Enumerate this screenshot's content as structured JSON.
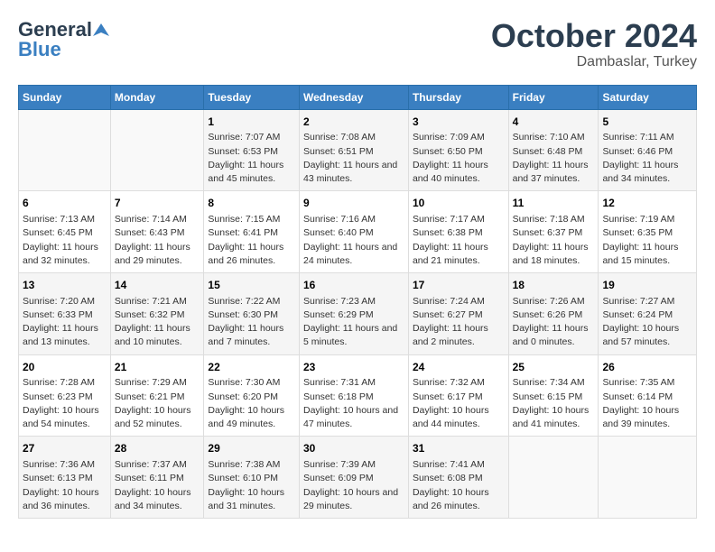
{
  "header": {
    "logo_general": "General",
    "logo_blue": "Blue",
    "month": "October 2024",
    "location": "Dambaslar, Turkey"
  },
  "days_of_week": [
    "Sunday",
    "Monday",
    "Tuesday",
    "Wednesday",
    "Thursday",
    "Friday",
    "Saturday"
  ],
  "weeks": [
    [
      {
        "day": "",
        "info": ""
      },
      {
        "day": "",
        "info": ""
      },
      {
        "day": "1",
        "info": "Sunrise: 7:07 AM\nSunset: 6:53 PM\nDaylight: 11 hours and 45 minutes."
      },
      {
        "day": "2",
        "info": "Sunrise: 7:08 AM\nSunset: 6:51 PM\nDaylight: 11 hours and 43 minutes."
      },
      {
        "day": "3",
        "info": "Sunrise: 7:09 AM\nSunset: 6:50 PM\nDaylight: 11 hours and 40 minutes."
      },
      {
        "day": "4",
        "info": "Sunrise: 7:10 AM\nSunset: 6:48 PM\nDaylight: 11 hours and 37 minutes."
      },
      {
        "day": "5",
        "info": "Sunrise: 7:11 AM\nSunset: 6:46 PM\nDaylight: 11 hours and 34 minutes."
      }
    ],
    [
      {
        "day": "6",
        "info": "Sunrise: 7:13 AM\nSunset: 6:45 PM\nDaylight: 11 hours and 32 minutes."
      },
      {
        "day": "7",
        "info": "Sunrise: 7:14 AM\nSunset: 6:43 PM\nDaylight: 11 hours and 29 minutes."
      },
      {
        "day": "8",
        "info": "Sunrise: 7:15 AM\nSunset: 6:41 PM\nDaylight: 11 hours and 26 minutes."
      },
      {
        "day": "9",
        "info": "Sunrise: 7:16 AM\nSunset: 6:40 PM\nDaylight: 11 hours and 24 minutes."
      },
      {
        "day": "10",
        "info": "Sunrise: 7:17 AM\nSunset: 6:38 PM\nDaylight: 11 hours and 21 minutes."
      },
      {
        "day": "11",
        "info": "Sunrise: 7:18 AM\nSunset: 6:37 PM\nDaylight: 11 hours and 18 minutes."
      },
      {
        "day": "12",
        "info": "Sunrise: 7:19 AM\nSunset: 6:35 PM\nDaylight: 11 hours and 15 minutes."
      }
    ],
    [
      {
        "day": "13",
        "info": "Sunrise: 7:20 AM\nSunset: 6:33 PM\nDaylight: 11 hours and 13 minutes."
      },
      {
        "day": "14",
        "info": "Sunrise: 7:21 AM\nSunset: 6:32 PM\nDaylight: 11 hours and 10 minutes."
      },
      {
        "day": "15",
        "info": "Sunrise: 7:22 AM\nSunset: 6:30 PM\nDaylight: 11 hours and 7 minutes."
      },
      {
        "day": "16",
        "info": "Sunrise: 7:23 AM\nSunset: 6:29 PM\nDaylight: 11 hours and 5 minutes."
      },
      {
        "day": "17",
        "info": "Sunrise: 7:24 AM\nSunset: 6:27 PM\nDaylight: 11 hours and 2 minutes."
      },
      {
        "day": "18",
        "info": "Sunrise: 7:26 AM\nSunset: 6:26 PM\nDaylight: 11 hours and 0 minutes."
      },
      {
        "day": "19",
        "info": "Sunrise: 7:27 AM\nSunset: 6:24 PM\nDaylight: 10 hours and 57 minutes."
      }
    ],
    [
      {
        "day": "20",
        "info": "Sunrise: 7:28 AM\nSunset: 6:23 PM\nDaylight: 10 hours and 54 minutes."
      },
      {
        "day": "21",
        "info": "Sunrise: 7:29 AM\nSunset: 6:21 PM\nDaylight: 10 hours and 52 minutes."
      },
      {
        "day": "22",
        "info": "Sunrise: 7:30 AM\nSunset: 6:20 PM\nDaylight: 10 hours and 49 minutes."
      },
      {
        "day": "23",
        "info": "Sunrise: 7:31 AM\nSunset: 6:18 PM\nDaylight: 10 hours and 47 minutes."
      },
      {
        "day": "24",
        "info": "Sunrise: 7:32 AM\nSunset: 6:17 PM\nDaylight: 10 hours and 44 minutes."
      },
      {
        "day": "25",
        "info": "Sunrise: 7:34 AM\nSunset: 6:15 PM\nDaylight: 10 hours and 41 minutes."
      },
      {
        "day": "26",
        "info": "Sunrise: 7:35 AM\nSunset: 6:14 PM\nDaylight: 10 hours and 39 minutes."
      }
    ],
    [
      {
        "day": "27",
        "info": "Sunrise: 7:36 AM\nSunset: 6:13 PM\nDaylight: 10 hours and 36 minutes."
      },
      {
        "day": "28",
        "info": "Sunrise: 7:37 AM\nSunset: 6:11 PM\nDaylight: 10 hours and 34 minutes."
      },
      {
        "day": "29",
        "info": "Sunrise: 7:38 AM\nSunset: 6:10 PM\nDaylight: 10 hours and 31 minutes."
      },
      {
        "day": "30",
        "info": "Sunrise: 7:39 AM\nSunset: 6:09 PM\nDaylight: 10 hours and 29 minutes."
      },
      {
        "day": "31",
        "info": "Sunrise: 7:41 AM\nSunset: 6:08 PM\nDaylight: 10 hours and 26 minutes."
      },
      {
        "day": "",
        "info": ""
      },
      {
        "day": "",
        "info": ""
      }
    ]
  ]
}
